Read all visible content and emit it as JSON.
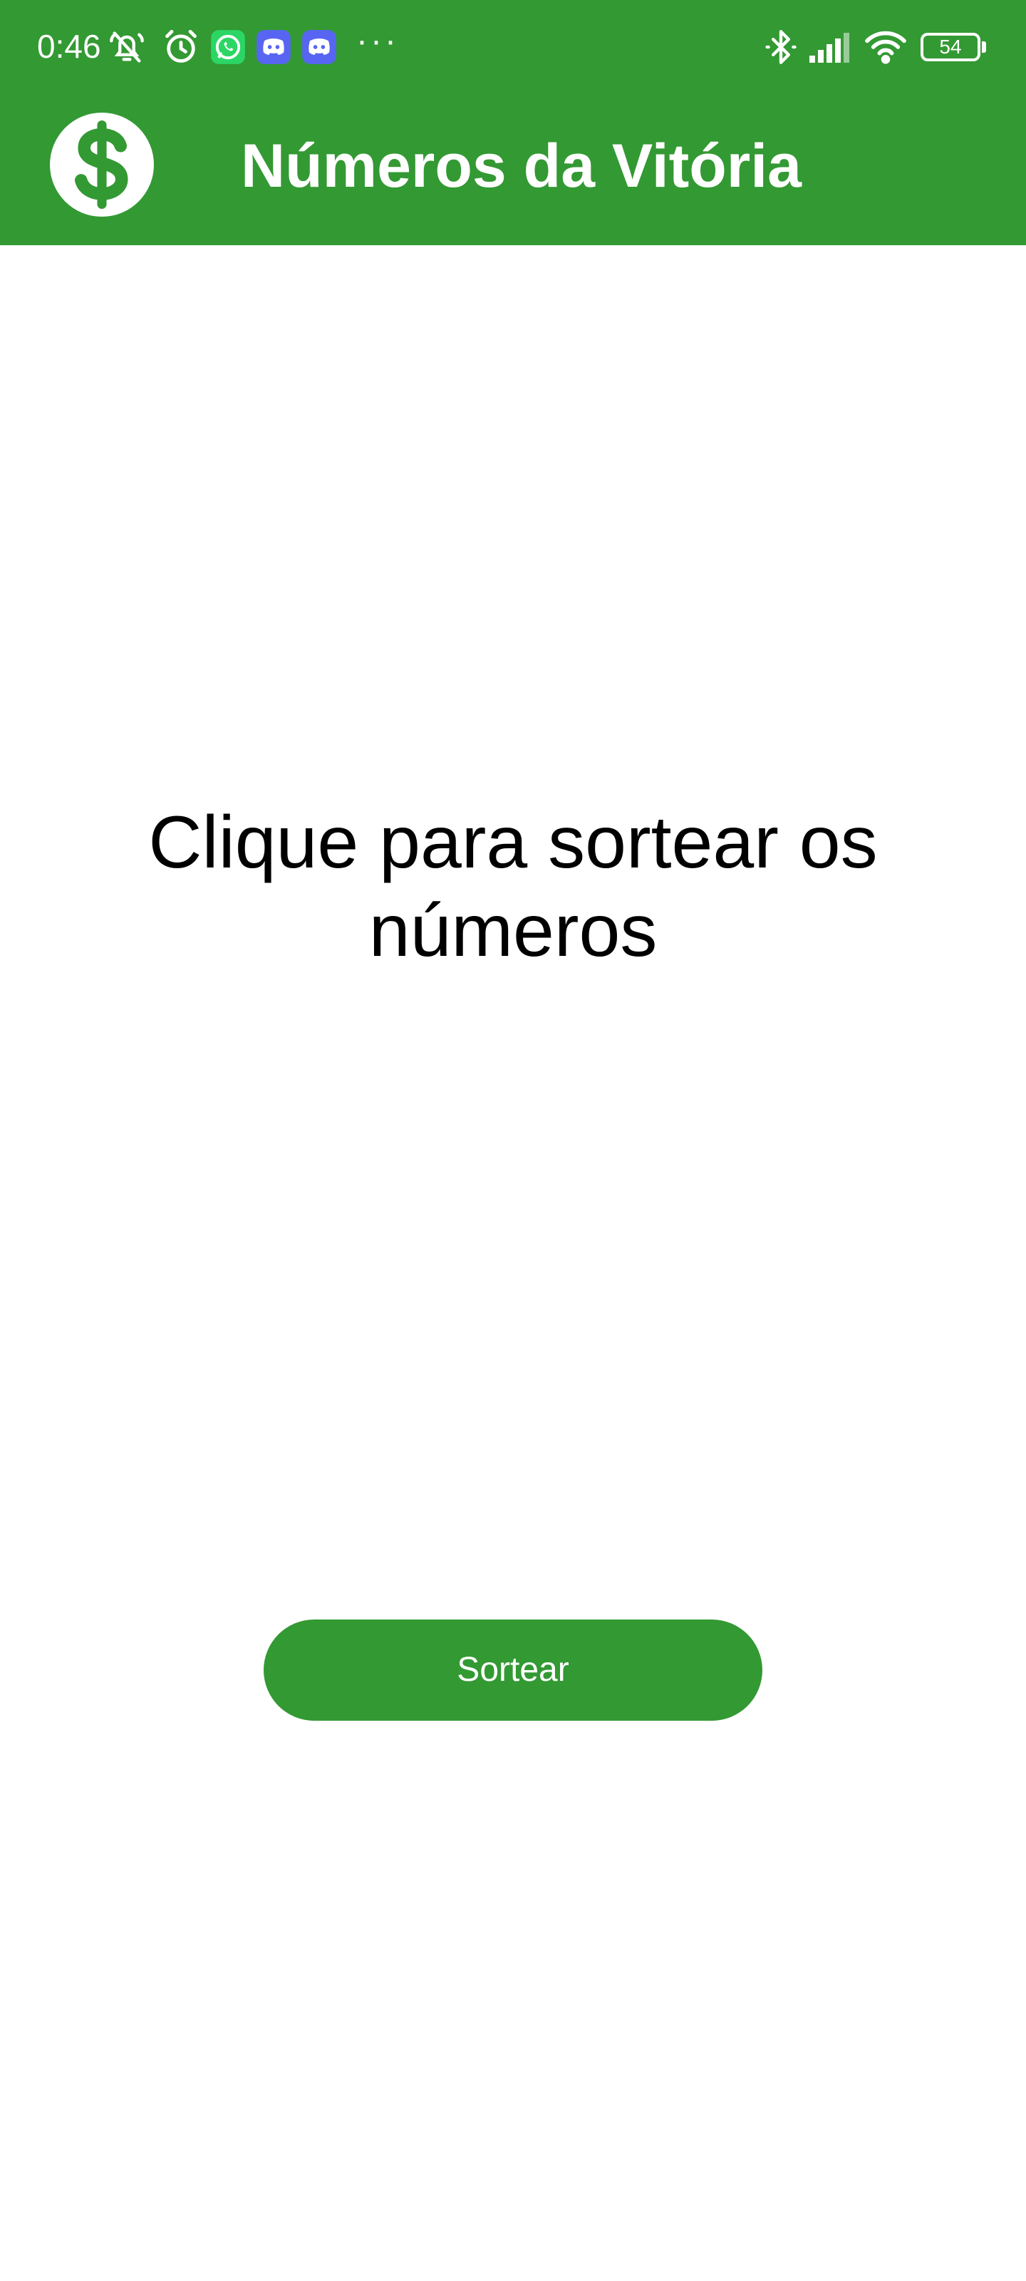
{
  "status_bar": {
    "time": "0:46",
    "battery_level": "54",
    "icons": [
      "notifications-muted-icon",
      "alarm-icon",
      "whatsapp-icon",
      "discord-icon",
      "discord-icon",
      "more-icon",
      "bluetooth-icon",
      "signal-icon",
      "wifi-icon",
      "battery-icon"
    ],
    "overflow": "···"
  },
  "app_bar": {
    "title": "Números da Vitória",
    "logo_icon": "dollar-sign-icon",
    "color": "#339933"
  },
  "main": {
    "prompt": "Clique para sortear os números",
    "button_label": "Sortear",
    "button_color": "#339933"
  }
}
